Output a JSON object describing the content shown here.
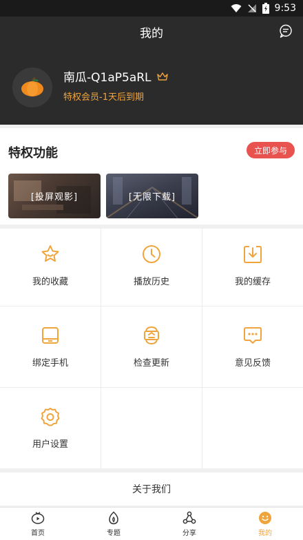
{
  "status_bar": {
    "time": "9:53"
  },
  "header": {
    "title": "我的",
    "username": "南瓜-Q1aP5aRL",
    "member_text": "特权会员-1天后到期"
  },
  "privilege": {
    "title": "特权功能",
    "join_label": "立即参与",
    "cards": [
      {
        "label": "[投屏观影]"
      },
      {
        "label": "[无限下载]"
      }
    ]
  },
  "menu": [
    {
      "label": "我的收藏",
      "icon": "star-icon"
    },
    {
      "label": "播放历史",
      "icon": "clock-icon"
    },
    {
      "label": "我的缓存",
      "icon": "download-icon"
    },
    {
      "label": "绑定手机",
      "icon": "tablet-icon"
    },
    {
      "label": "检查更新",
      "icon": "update-icon"
    },
    {
      "label": "意见反馈",
      "icon": "feedback-icon"
    },
    {
      "label": "用户设置",
      "icon": "gear-icon"
    }
  ],
  "about": {
    "label": "关于我们"
  },
  "tabs": [
    {
      "label": "首页",
      "icon": "home-play-icon"
    },
    {
      "label": "专题",
      "icon": "topic-icon"
    },
    {
      "label": "分享",
      "icon": "share-icon"
    },
    {
      "label": "我的",
      "icon": "smile-icon"
    }
  ],
  "colors": {
    "accent": "#f0a43c",
    "join_button": "#e8524f",
    "header_bg": "#2b2b2b"
  }
}
